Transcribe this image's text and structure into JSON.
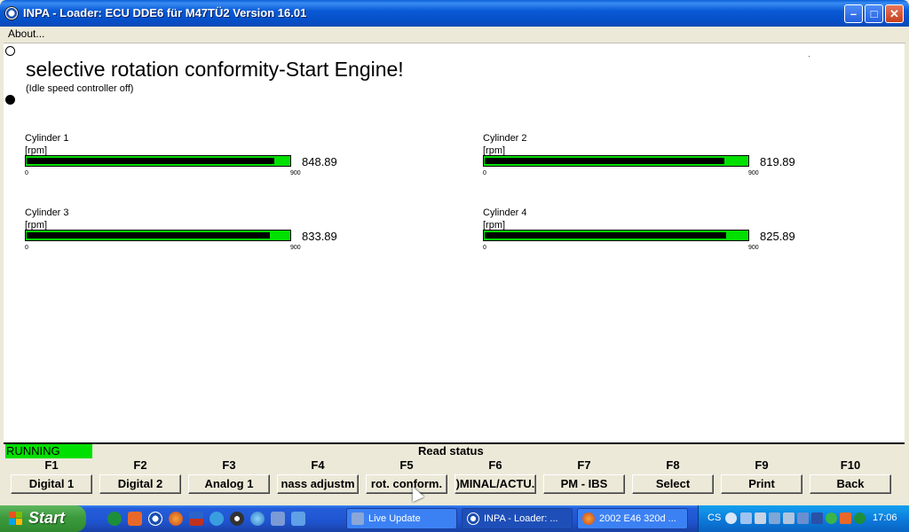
{
  "window": {
    "title": "INPA - Loader:  ECU DDE6 für M47TÜ2 Version 16.01",
    "controls": {
      "minimize": "–",
      "maximize": "□",
      "close": "✕"
    }
  },
  "menu": {
    "about": "About..."
  },
  "main": {
    "headline": "selective rotation conformity-Start Engine!",
    "subline": "(Idle speed controller off)"
  },
  "gauges": [
    {
      "label": "Cylinder 1",
      "unit": "[rpm]",
      "value": 848.89,
      "value_text": "848.89",
      "min": "0",
      "max": "900",
      "fill": 0.943
    },
    {
      "label": "Cylinder 2",
      "unit": "[rpm]",
      "value": 819.89,
      "value_text": "819.89",
      "min": "0",
      "max": "900",
      "fill": 0.911
    },
    {
      "label": "Cylinder 3",
      "unit": "[rpm]",
      "value": 833.89,
      "value_text": "833.89",
      "min": "0",
      "max": "900",
      "fill": 0.927
    },
    {
      "label": "Cylinder 4",
      "unit": "[rpm]",
      "value": 825.89,
      "value_text": "825.89",
      "min": "0",
      "max": "900",
      "fill": 0.918
    }
  ],
  "status": {
    "running": "RUNNING",
    "title": "Read status",
    "running_color": "#00e000"
  },
  "fkeys": [
    {
      "key": "F1",
      "label": "Digital 1"
    },
    {
      "key": "F2",
      "label": "Digital 2"
    },
    {
      "key": "F3",
      "label": "Analog 1"
    },
    {
      "key": "F4",
      "label": "nass adjustm"
    },
    {
      "key": "F5",
      "label": "rot. conform."
    },
    {
      "key": "F6",
      "label": ")MINAL/ACTU."
    },
    {
      "key": "F7",
      "label": "PM - IBS"
    },
    {
      "key": "F8",
      "label": "Select"
    },
    {
      "key": "F9",
      "label": "Print"
    },
    {
      "key": "F10",
      "label": "Back"
    }
  ],
  "taskbar": {
    "start": "Start",
    "tasks": [
      {
        "label": "Live Update",
        "icon": "live-update-icon"
      },
      {
        "label": "INPA - Loader: ...",
        "icon": "bmw-icon",
        "active": true
      },
      {
        "label": "2002 E46 320d ...",
        "icon": "firefox-icon"
      }
    ],
    "language": "CS",
    "clock": "17:06"
  }
}
